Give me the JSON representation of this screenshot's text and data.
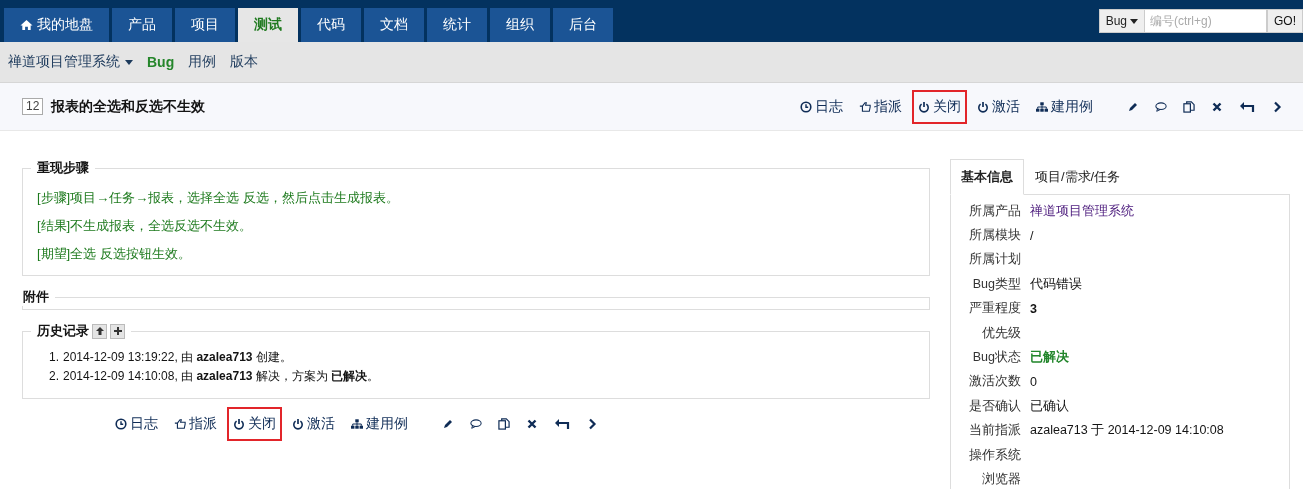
{
  "main_nav": [
    {
      "label": "我的地盘",
      "selected": false
    },
    {
      "label": "产品",
      "selected": false
    },
    {
      "label": "项目",
      "selected": false
    },
    {
      "label": "测试",
      "selected": true
    },
    {
      "label": "代码",
      "selected": false
    },
    {
      "label": "文档",
      "selected": false
    },
    {
      "label": "统计",
      "selected": false
    },
    {
      "label": "组织",
      "selected": false
    },
    {
      "label": "后台",
      "selected": false
    }
  ],
  "quick_search": {
    "type": "Bug",
    "placeholder": "编号(ctrl+g)",
    "button": "GO!"
  },
  "sub_nav": {
    "product": "禅道项目管理系统",
    "items": [
      {
        "label": "Bug",
        "selected": true
      },
      {
        "label": "用例",
        "selected": false
      },
      {
        "label": "版本",
        "selected": false
      }
    ]
  },
  "bug": {
    "id": "12",
    "title": "报表的全选和反选不生效"
  },
  "actions_top": [
    {
      "kind": "log",
      "label": "日志",
      "highlighted": false
    },
    {
      "kind": "assign",
      "label": "指派",
      "highlighted": false
    },
    {
      "kind": "close",
      "label": "关闭",
      "highlighted": true
    },
    {
      "kind": "activate",
      "label": "激活",
      "highlighted": false
    },
    {
      "kind": "case",
      "label": "建用例",
      "highlighted": false
    },
    {
      "kind": "edit"
    },
    {
      "kind": "comment"
    },
    {
      "kind": "copy"
    },
    {
      "kind": "delete"
    },
    {
      "kind": "back"
    },
    {
      "kind": "next"
    }
  ],
  "steps": {
    "legend": "重现步骤",
    "lines": [
      "[步骤]项目→任务→报表，选择全选 反选，然后点击生成报表。",
      "[结果]不生成报表，全选反选不生效。",
      "[期望]全选 反选按钮生效。"
    ]
  },
  "files": {
    "legend": "附件"
  },
  "history": {
    "legend": "历史记录",
    "entries": [
      {
        "number": "1.",
        "text": "2014-12-09 13:19:22, 由 **azalea713** 创建。"
      },
      {
        "number": "2.",
        "text": "2014-12-09 14:10:08, 由 **azalea713** 解决，方案为 **已解决**。"
      }
    ]
  },
  "actions_bottom": [
    {
      "kind": "log",
      "label": "日志",
      "highlighted": false
    },
    {
      "kind": "assign",
      "label": "指派",
      "highlighted": false
    },
    {
      "kind": "close",
      "label": "关闭",
      "highlighted": true
    },
    {
      "kind": "activate",
      "label": "激活",
      "highlighted": false
    },
    {
      "kind": "case",
      "label": "建用例",
      "highlighted": false
    },
    {
      "kind": "edit"
    },
    {
      "kind": "comment"
    },
    {
      "kind": "copy"
    },
    {
      "kind": "delete"
    },
    {
      "kind": "back"
    },
    {
      "kind": "next"
    }
  ],
  "side_tabs": [
    {
      "label": "基本信息",
      "selected": true
    },
    {
      "label": "项目/需求/任务",
      "selected": false
    }
  ],
  "info": [
    {
      "label": "所属产品",
      "kind": "link",
      "value": "禅道项目管理系统"
    },
    {
      "label": "所属模块",
      "kind": "text",
      "value": "/"
    },
    {
      "label": "所属计划"
    },
    {
      "label": "Bug类型",
      "kind": "text",
      "value": "代码错误"
    },
    {
      "label": "严重程度",
      "kind": "strong",
      "value": "3"
    },
    {
      "label": "优先级"
    },
    {
      "label": "Bug状态",
      "kind": "status",
      "value": "已解决"
    },
    {
      "label": "激活次数",
      "kind": "text",
      "value": "0"
    },
    {
      "label": "是否确认",
      "kind": "text",
      "value": "已确认"
    },
    {
      "label": "当前指派",
      "kind": "text",
      "value": "azalea713 于 2014-12-09 14:10:08"
    },
    {
      "label": "操作系统"
    },
    {
      "label": "浏览器"
    }
  ]
}
